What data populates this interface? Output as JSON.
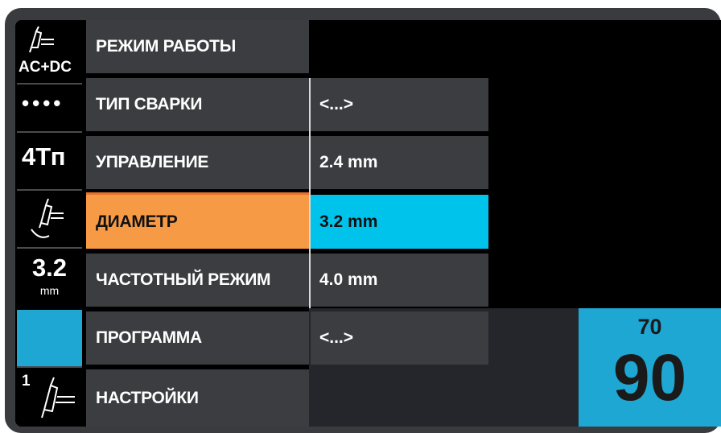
{
  "sidebar": {
    "mode_label": "AC+DC",
    "dots": "••••",
    "cycle": "4Тп",
    "diameter_value": "3.2",
    "diameter_unit": "mm",
    "torch_number": "1"
  },
  "menu": {
    "items": [
      {
        "label": "РЕЖИМ РАБОТЫ"
      },
      {
        "label": "ТИП СВАРКИ"
      },
      {
        "label": "УПРАВЛЕНИЕ"
      },
      {
        "label": "ДИАМЕТР"
      },
      {
        "label": "ЧАСТОТНЫЙ РЕЖИМ"
      },
      {
        "label": "ПРОГРАММА"
      },
      {
        "label": "НАСТРОЙКИ"
      }
    ],
    "active_index": 3
  },
  "submenu": {
    "items": [
      {
        "label": "<...>"
      },
      {
        "label": "2.4 mm"
      },
      {
        "label": "3.2 mm"
      },
      {
        "label": "4.0 mm"
      },
      {
        "label": "<...>"
      }
    ],
    "active_index": 2
  },
  "readout": {
    "small_value": "70",
    "large_value": "90"
  },
  "colors": {
    "menu_bg": "#3c3d40",
    "active_menu": "#f79a46",
    "active_sub": "#00c3ec",
    "value_box": "#1fa7d3"
  }
}
